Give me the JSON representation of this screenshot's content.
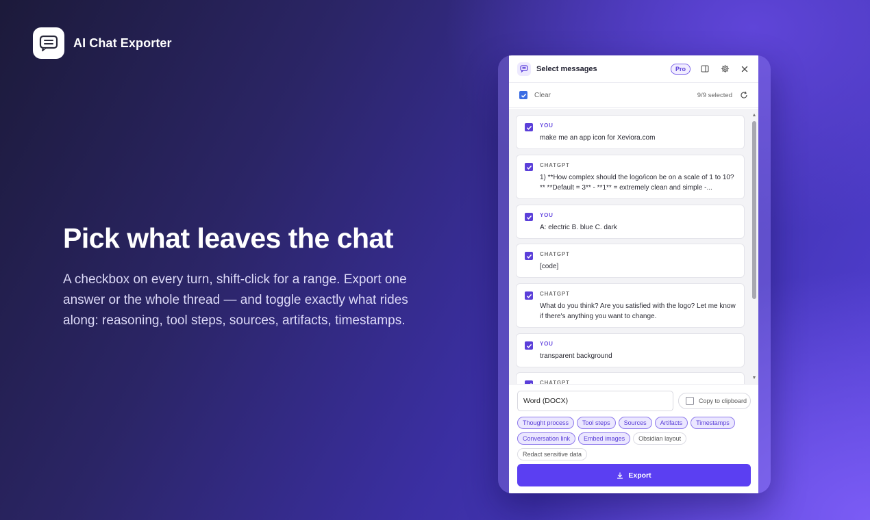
{
  "brand": {
    "name": "AI Chat Exporter",
    "icon": "chat-list-icon"
  },
  "hero": {
    "title": "Pick what leaves the chat",
    "description": "A checkbox on every turn, shift-click for a range. Export one answer or the whole thread — and toggle exactly what rides along: reasoning, tool steps, sources, artifacts, timestamps."
  },
  "panel": {
    "header": {
      "title": "Select messages",
      "badge": "Pro",
      "icons": [
        "sidebar-icon",
        "gear-icon",
        "close-icon"
      ]
    },
    "toolbar": {
      "clear_label": "Clear",
      "selected_count": "9/9 selected"
    },
    "messages": [
      {
        "role": "YOU",
        "text": "make me an app icon for Xeviora.com",
        "checked": true
      },
      {
        "role": "CHATGPT",
        "text": "1) **How complex should the logo/icon be on a scale of 1 to 10?** **Default = 3** - **1** = extremely clean and simple -...",
        "checked": true
      },
      {
        "role": "YOU",
        "text": "A: electric B. blue C. dark",
        "checked": true
      },
      {
        "role": "CHATGPT",
        "text": "[code]",
        "checked": true
      },
      {
        "role": "CHATGPT",
        "text": "What do you think? Are you satisfied with the logo? Let me know if there's anything you want to change.",
        "checked": true
      },
      {
        "role": "YOU",
        "text": "transparent background",
        "checked": true
      },
      {
        "role": "CHATGPT",
        "text": "",
        "checked": true
      }
    ],
    "footer": {
      "format": "Word (DOCX)",
      "copy_label": "Copy to clipboard",
      "copy_checked": false,
      "options": [
        [
          {
            "label": "Thought process",
            "on": true
          },
          {
            "label": "Tool steps",
            "on": true
          },
          {
            "label": "Sources",
            "on": true
          },
          {
            "label": "Artifacts",
            "on": true
          },
          {
            "label": "Timestamps",
            "on": true
          }
        ],
        [
          {
            "label": "Conversation link",
            "on": true
          },
          {
            "label": "Embed images",
            "on": true
          },
          {
            "label": "Obsidian layout",
            "on": false
          }
        ],
        [
          {
            "label": "Redact sensitive data",
            "on": false
          }
        ]
      ],
      "export_label": "Export"
    }
  },
  "colors": {
    "accent": "#5b3ff2",
    "checkbox_header": "#3b6de3",
    "checkbox_item": "#5b3fd9"
  }
}
